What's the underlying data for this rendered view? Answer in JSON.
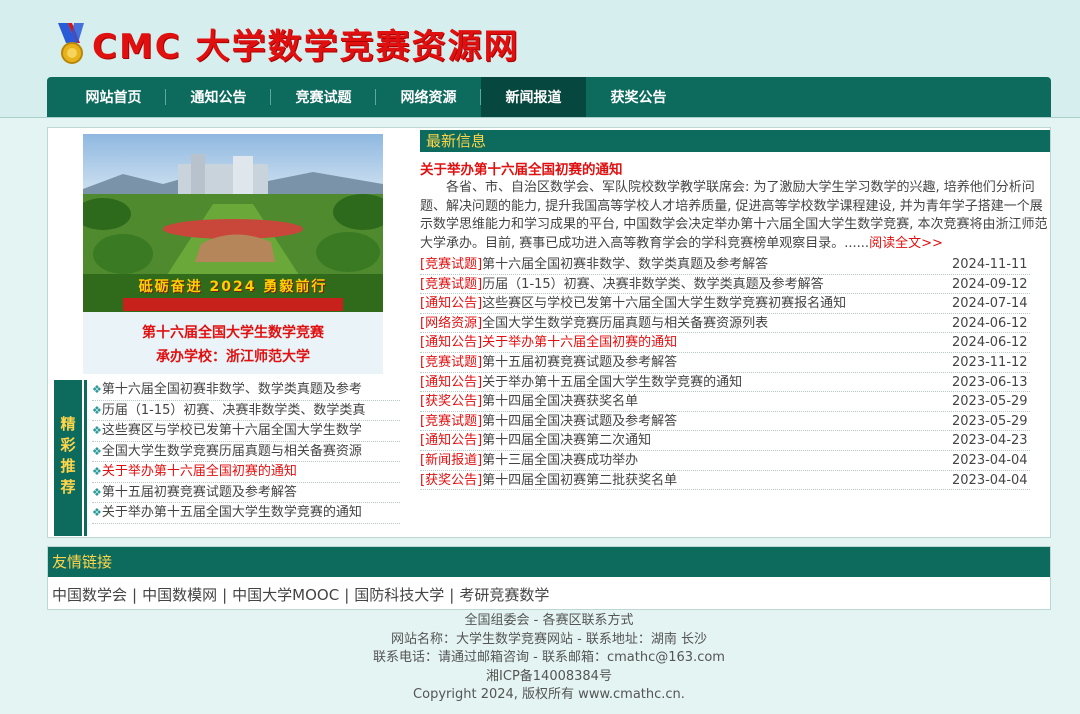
{
  "header": {
    "logo_text": "CMC 大学数学竞赛资源网"
  },
  "nav": [
    {
      "label": "网站首页"
    },
    {
      "label": "通知公告"
    },
    {
      "label": "竞赛试题"
    },
    {
      "label": "网络资源"
    },
    {
      "label": "新闻报道"
    },
    {
      "label": "获奖公告"
    }
  ],
  "banner": {
    "slogan": "砥砺奋进 2024 勇毅前行",
    "caption_1": "第十六届全国大学生数学竞赛",
    "caption_2": "承办学校：浙江师范大学"
  },
  "recommend": {
    "label": "精彩推荐",
    "items": [
      {
        "text": "第十六届全国初赛非数学、数学类真题及参考",
        "red": false
      },
      {
        "text": "历届（1-15）初赛、决赛非数学类、数学类真",
        "red": false
      },
      {
        "text": "这些赛区与学校已发第十六届全国大学生数学",
        "red": false
      },
      {
        "text": "全国大学生数学竞赛历届真题与相关备赛资源",
        "red": false
      },
      {
        "text": "关于举办第十六届全国初赛的通知",
        "red": true
      },
      {
        "text": "第十五届初赛竞赛试题及参考解答",
        "red": false
      },
      {
        "text": "关于举办第十五届全国大学生数学竞赛的通知",
        "red": false
      }
    ]
  },
  "latest": {
    "title": "最新信息",
    "featured_title": "关于举办第十六届全国初赛的通知",
    "featured_body": "各省、市、自治区数学会、军队院校数学教学联席会: 为了激励大学生学习数学的兴趣, 培养他们分析问题、解决问题的能力, 提升我国高等学校人才培养质量, 促进高等学校数学课程建设, 并为青年学子搭建一个展示数学思维能力和学习成果的平台, 中国数学会决定举办第十六届全国大学生数学竞赛, 本次竞赛将由浙江师范大学承办。目前, 赛事已成功进入高等教育学会的学科竞赛榜单观察目录。......",
    "read_more": "阅读全文>>",
    "items": [
      {
        "cat": "竞赛试题",
        "title": "第十六届全国初赛非数学、数学类真题及参考解答",
        "date": "2024-11-11",
        "red": false
      },
      {
        "cat": "竞赛试题",
        "title": "历届（1-15）初赛、决赛非数学类、数学类真题及参考解答",
        "date": "2024-09-12",
        "red": false
      },
      {
        "cat": "通知公告",
        "title": "这些赛区与学校已发第十六届全国大学生数学竞赛初赛报名通知",
        "date": "2024-07-14",
        "red": false
      },
      {
        "cat": "网络资源",
        "title": "全国大学生数学竞赛历届真题与相关备赛资源列表",
        "date": "2024-06-12",
        "red": false
      },
      {
        "cat": "通知公告",
        "title": "关于举办第十六届全国初赛的通知",
        "date": "2024-06-12",
        "red": true
      },
      {
        "cat": "竞赛试题",
        "title": "第十五届初赛竞赛试题及参考解答",
        "date": "2023-11-12",
        "red": false
      },
      {
        "cat": "通知公告",
        "title": "关于举办第十五届全国大学生数学竞赛的通知",
        "date": "2023-06-13",
        "red": false
      },
      {
        "cat": "获奖公告",
        "title": "第十四届全国决赛获奖名单",
        "date": "2023-05-29",
        "red": false
      },
      {
        "cat": "竞赛试题",
        "title": "第十四届全国决赛试题及参考解答",
        "date": "2023-05-29",
        "red": false
      },
      {
        "cat": "通知公告",
        "title": "第十四届全国决赛第二次通知",
        "date": "2023-04-23",
        "red": false
      },
      {
        "cat": "新闻报道",
        "title": "第十三届全国决赛成功举办",
        "date": "2023-04-04",
        "red": false
      },
      {
        "cat": "获奖公告",
        "title": "第十四届全国初赛第二批获奖名单",
        "date": "2023-04-04",
        "red": false
      }
    ]
  },
  "links": {
    "title": "友情链接",
    "separator": "|",
    "items": [
      "中国数学会",
      "中国数模网",
      "中国大学MOOC",
      "国防科技大学",
      "考研竞赛数学"
    ]
  },
  "footer": {
    "line1": "全国组委会 - 各赛区联系方式",
    "line2": "网站名称：大学生数学竞赛网站 - 联系地址：湖南 长沙",
    "line3": "联系电话：请通过邮箱咨询 - 联系邮箱：cmathc@163.com",
    "line4": "湘ICP备14008384号",
    "line5": "Copyright 2024, 版权所有 www.cmathc.cn."
  },
  "colors": {
    "primary": "#0d6b5e",
    "accent_red": "#e01010",
    "title_yellow": "#ffd54a"
  }
}
